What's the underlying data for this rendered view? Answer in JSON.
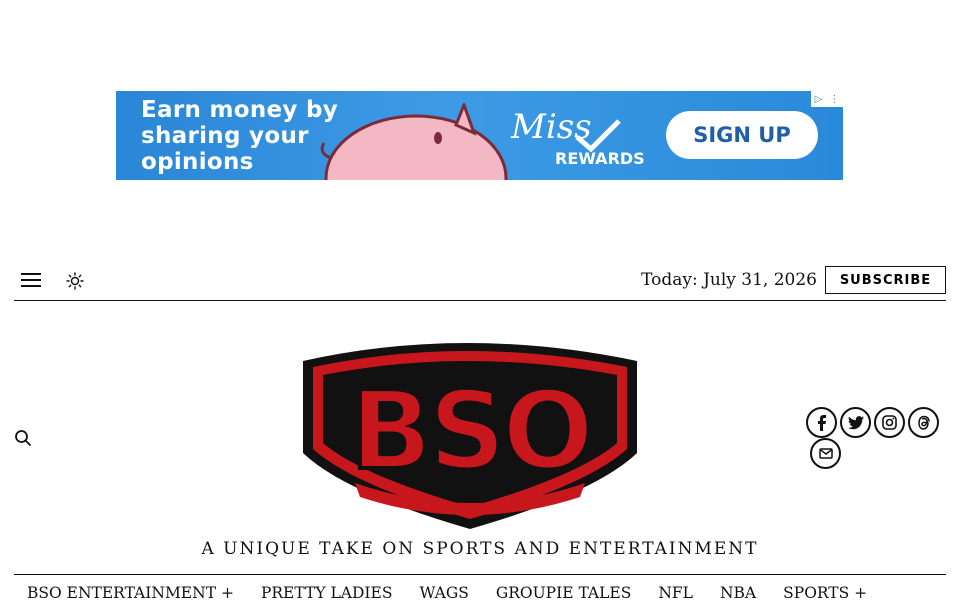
{
  "ad": {
    "line1": "Earn money by",
    "line2": "sharing your",
    "line3": "opinions",
    "brand_top": "Miss",
    "brand_bottom": "REWARDS",
    "cta": "SIGN UP",
    "choices_icon": "adchoices-icon",
    "colors": {
      "bg": "#2a86d6",
      "pig": "#f4b8c4"
    }
  },
  "topbar": {
    "menu_icon": "hamburger-menu-icon",
    "theme_icon": "sun-icon",
    "date": "Today: July 31, 2026",
    "subscribe": "SUBSCRIBE"
  },
  "masthead": {
    "logo_text": "BSO",
    "tagline": "A UNIQUE TAKE ON SPORTS AND ENTERTAINMENT",
    "search_icon": "search-icon",
    "social": [
      "facebook-icon",
      "twitter-icon",
      "instagram-icon",
      "threads-icon",
      "email-icon"
    ],
    "colors": {
      "red": "#c8161d",
      "black": "#111111"
    }
  },
  "nav": {
    "items": [
      {
        "label": "BSO ENTERTAINMENT +"
      },
      {
        "label": "PRETTY LADIES"
      },
      {
        "label": "WAGS"
      },
      {
        "label": "GROUPIE TALES"
      },
      {
        "label": "NFL"
      },
      {
        "label": "NBA"
      },
      {
        "label": "SPORTS +"
      }
    ]
  }
}
